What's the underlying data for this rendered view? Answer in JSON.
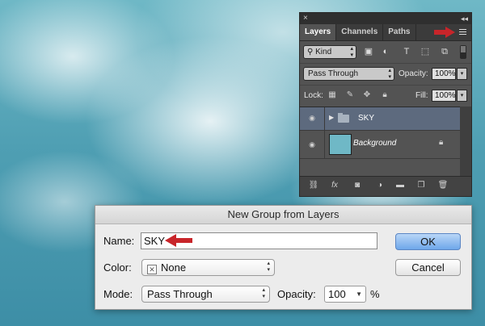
{
  "layers_panel": {
    "close_glyph": "×",
    "collapse_glyph": "◂◂",
    "tabs": [
      {
        "label": "Layers",
        "active": true
      },
      {
        "label": "Channels",
        "active": false
      },
      {
        "label": "Paths",
        "active": false
      }
    ],
    "filter": {
      "kind_label": "Kind",
      "icons": [
        "image-filter-icon",
        "adjustment-filter-icon",
        "type-filter-icon",
        "shape-filter-icon",
        "smart-object-filter-icon"
      ]
    },
    "blend_mode": "Pass Through",
    "opacity_label": "Opacity:",
    "opacity_value": "100%",
    "lock_label": "Lock:",
    "fill_label": "Fill:",
    "fill_value": "100%",
    "layers": [
      {
        "name": "SKY",
        "type": "group",
        "selected": true
      },
      {
        "name": "Background",
        "type": "image",
        "locked": true
      }
    ],
    "bottom_icons": [
      "link-icon",
      "fx-icon",
      "mask-icon",
      "adjustment-icon",
      "folder-icon",
      "new-layer-icon",
      "trash-icon"
    ],
    "fx_label": "fx"
  },
  "dialog": {
    "title": "New Group from Layers",
    "name_label": "Name:",
    "name_value": "SKY",
    "color_label": "Color:",
    "color_value": "None",
    "mode_label": "Mode:",
    "mode_value": "Pass Through",
    "opacity_label": "Opacity:",
    "opacity_value": "100",
    "opacity_unit": "%",
    "ok_label": "OK",
    "cancel_label": "Cancel"
  },
  "colors": {
    "annotation_arrow": "#c8252a",
    "ok_button": "#6ea7ea",
    "selected_layer": "#5d6a7e"
  }
}
